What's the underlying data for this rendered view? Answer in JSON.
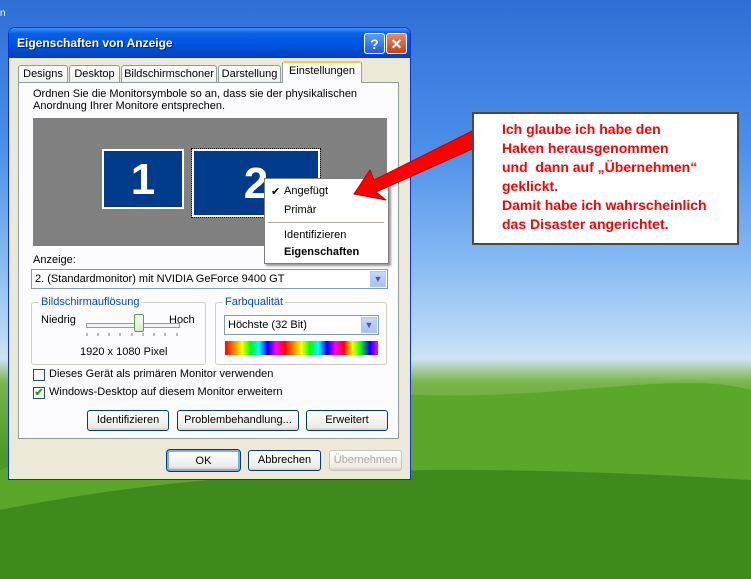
{
  "window": {
    "title": "Eigenschaften von Anzeige",
    "help_glyph": "?",
    "close_glyph": "✕"
  },
  "tabs": [
    {
      "label": "Designs"
    },
    {
      "label": "Desktop"
    },
    {
      "label": "Bildschirmschoner"
    },
    {
      "label": "Darstellung"
    },
    {
      "label": "Einstellungen",
      "active": true
    }
  ],
  "settings": {
    "description": "Ordnen Sie die Monitorsymbole so an, dass sie der physikalischen Anordnung Ihrer Monitore entsprechen.",
    "monitors": [
      {
        "label": "1"
      },
      {
        "label": "2"
      }
    ],
    "context_menu": {
      "items": [
        {
          "label": "Angefügt",
          "checked": true
        },
        {
          "label": "Primär"
        },
        {
          "label": "Identifizieren"
        },
        {
          "label": "Eigenschaften",
          "bold": true
        }
      ]
    },
    "display_label": "Anzeige:",
    "display_value": "2. (Standardmonitor) mit NVIDIA GeForce 9400 GT",
    "resolution": {
      "group_title": "Bildschirmauflösung",
      "low_label": "Niedrig",
      "high_label": "Hoch",
      "value": "1920 x 1080 Pixel",
      "slider_fraction": 0.55
    },
    "color": {
      "group_title": "Farbqualität",
      "value": "Höchste (32 Bit)"
    },
    "checkbox_primary": {
      "label": "Dieses Gerät als primären Monitor verwenden",
      "checked": false
    },
    "checkbox_extend": {
      "label": "Windows-Desktop auf diesem Monitor erweitern",
      "checked": true
    },
    "buttons": {
      "identify": "Identifizieren",
      "troubleshoot": "Problembehandlung...",
      "advanced": "Erweitert"
    }
  },
  "dialog_buttons": {
    "ok": "OK",
    "cancel": "Abbrechen",
    "apply": "Übernehmen"
  },
  "annotation": {
    "text": "Ich glaube ich habe den\nHaken herausgenommen\nund  dann auf „Übernehmen“\ngeklickt.\nDamit habe ich wahrscheinlich\ndas Disaster angerichtet.",
    "color": "#ff0000"
  },
  "colors": {
    "titlebar": "#0055e5",
    "monitor": "#003b8c",
    "checkmark": "#21a121"
  }
}
